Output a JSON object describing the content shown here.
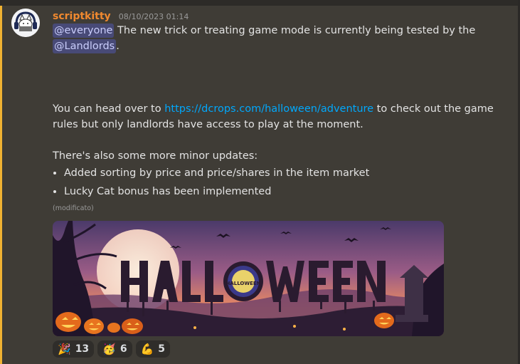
{
  "message": {
    "author": "scriptkitty",
    "timestamp": "08/10/2023 01:14",
    "line1": {
      "mention": "@everyone",
      "text": " The new trick or treating game mode is currently being tested by the"
    },
    "line2": {
      "mention": "@Landlords",
      "text": "."
    },
    "para2": {
      "prefix": "You can head over to ",
      "link": "https://dcrops.com/halloween/adventure",
      "suffix": " to check out the game",
      "line2": "rules but only landlords have access to play at the moment."
    },
    "para3": "There's also some more minor updates:",
    "bullets": [
      "Added sorting by price and price/shares in the item market",
      "Lucky Cat bonus has been implemented"
    ],
    "edited_label": "(modificato)",
    "banner_text": "HALLOWEEN"
  },
  "reactions": [
    {
      "emoji": "🎉",
      "count": "13",
      "icon": "party-popper"
    },
    {
      "emoji": "🥳",
      "count": "6",
      "icon": "partying-face"
    },
    {
      "emoji": "💪",
      "count": "5",
      "icon": "flexed-biceps"
    }
  ],
  "colors": {
    "background": "#3f3c36",
    "username": "#f0892f",
    "link": "#00a8fc",
    "accent_bar": "#f0b232",
    "mention_bg": "#5865f2"
  }
}
